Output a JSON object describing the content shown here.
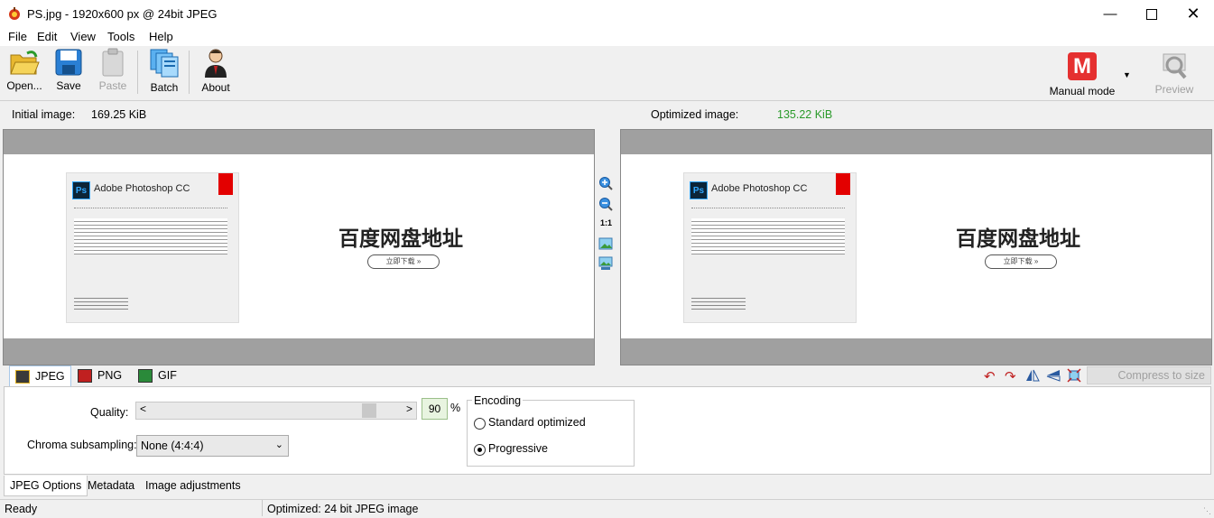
{
  "window": {
    "title": "PS.jpg - 1920x600 px @ 24bit JPEG"
  },
  "menu": [
    "File",
    "Edit",
    "View",
    "Tools",
    "Help"
  ],
  "toolbar": {
    "open": "Open...",
    "save": "Save",
    "paste": "Paste",
    "batch": "Batch",
    "about": "About",
    "mode": "Manual mode",
    "mode_letter": "M",
    "preview": "Preview"
  },
  "info": {
    "initial_label": "Initial image:",
    "initial_size": "169.25 KiB",
    "optimized_label": "Optimized image:",
    "optimized_size": "135.22 KiB"
  },
  "preview_content": {
    "app_title": "Adobe Photoshop CC",
    "heading": "百度网盘地址",
    "button": "立即下载 »"
  },
  "zoom": {
    "one_to_one": "1:1"
  },
  "format_tabs": [
    "JPEG",
    "PNG",
    "GIF"
  ],
  "compress_to_size": "Compress to size",
  "options": {
    "quality_label": "Quality:",
    "quality_value": "90",
    "quality_unit": "%",
    "chroma_label": "Chroma subsampling:",
    "chroma_value": "None (4:4:4)",
    "encoding_title": "Encoding",
    "encoding_standard": "Standard optimized",
    "encoding_progressive": "Progressive",
    "encoding_selected": "Progressive"
  },
  "bottom_tabs": [
    "JPEG Options",
    "Metadata",
    "Image adjustments"
  ],
  "status": {
    "left": "Ready",
    "right": "Optimized: 24 bit JPEG image"
  },
  "colors": {
    "optimized_size": "#2a9a2a",
    "mode_badge": "#e53030",
    "adobe_red": "#e30000"
  }
}
